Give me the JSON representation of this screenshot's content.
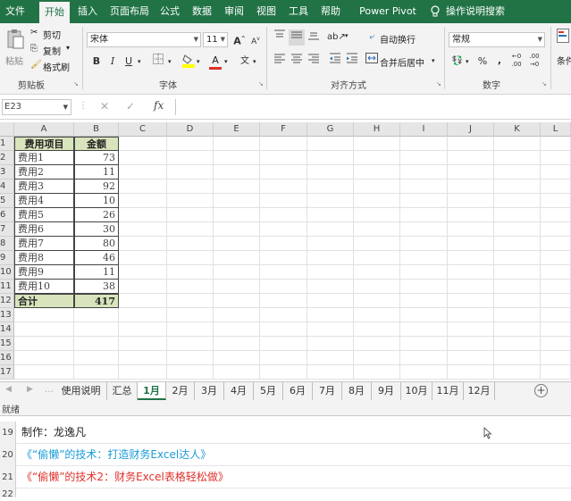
{
  "ribbon_tabs": [
    "文件",
    "开始",
    "插入",
    "页面布局",
    "公式",
    "数据",
    "审阅",
    "视图",
    "工具",
    "帮助",
    "Power Pivot",
    "操作说明搜索"
  ],
  "active_tab": "开始",
  "clipboard": {
    "paste": "粘贴",
    "cut": "剪切",
    "copy": "复制",
    "format_painter": "格式刷",
    "group": "剪贴板"
  },
  "font": {
    "name": "宋体",
    "size": "11",
    "bold": "B",
    "italic": "I",
    "underline": "U",
    "grow": "A",
    "shrink": "A",
    "font_color": "A",
    "phonetic": "文",
    "group": "字体"
  },
  "alignment": {
    "wrap": "自动换行",
    "merge": "合并后居中",
    "group": "对齐方式"
  },
  "number": {
    "format": "常规",
    "percent": "%",
    "comma": ",",
    "group": "数字"
  },
  "styles": {
    "cond": "条件"
  },
  "formula_bar": {
    "name_box": "E23",
    "fx": "fx",
    "cancel": "✕",
    "enter": "✓",
    "value": ""
  },
  "columns": [
    "A",
    "B",
    "C",
    "D",
    "E",
    "F",
    "G",
    "H",
    "I",
    "J",
    "K",
    "L"
  ],
  "rows": [
    "1",
    "2",
    "3",
    "4",
    "5",
    "6",
    "7",
    "8",
    "9",
    "10",
    "11",
    "12",
    "13",
    "14",
    "15",
    "16",
    "17"
  ],
  "table": {
    "headers": [
      "费用项目",
      "金额"
    ],
    "items": [
      {
        "name": "费用1",
        "value": "73"
      },
      {
        "name": "费用2",
        "value": "11"
      },
      {
        "name": "费用3",
        "value": "92"
      },
      {
        "name": "费用4",
        "value": "10"
      },
      {
        "name": "费用5",
        "value": "26"
      },
      {
        "name": "费用6",
        "value": "30"
      },
      {
        "name": "费用7",
        "value": "80"
      },
      {
        "name": "费用8",
        "value": "46"
      },
      {
        "name": "费用9",
        "value": "11"
      },
      {
        "name": "费用10",
        "value": "38"
      }
    ],
    "total_label": "合计",
    "total_value": "417"
  },
  "sheet_tabs": [
    "使用说明",
    "汇总",
    "1月",
    "2月",
    "3月",
    "4月",
    "5月",
    "6月",
    "7月",
    "8月",
    "9月",
    "10月",
    "11月",
    "12月"
  ],
  "active_sheet": "1月",
  "status": "就绪",
  "lower": {
    "rows": [
      {
        "num": "19",
        "text": "制作：龙逸凡",
        "color": "#222222"
      },
      {
        "num": "20",
        "text": "《“偷懒”的技术：打造财务Excel达人》",
        "color": "#1a9bd7"
      },
      {
        "num": "21",
        "text": "《“偷懒”的技术2：财务Excel表格轻松做》",
        "color": "#e0302a"
      },
      {
        "num": "22",
        "text": "",
        "color": "#222222"
      }
    ]
  },
  "colors": {
    "brand": "#217346",
    "header_fill": "#d8e4bc"
  }
}
